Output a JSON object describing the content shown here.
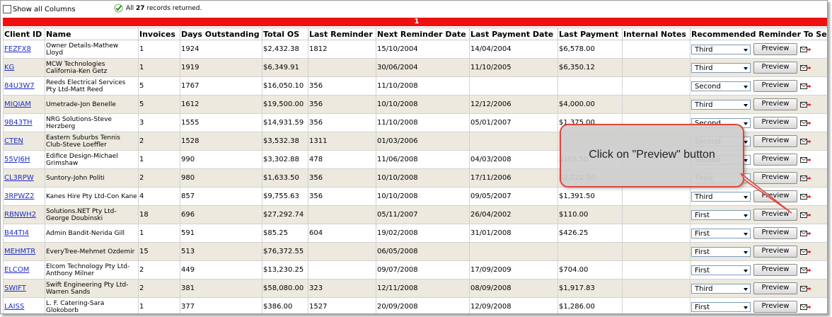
{
  "toolbar": {
    "show_all_label": "Show all Columns",
    "records_prefix": "All",
    "records_count": "27",
    "records_suffix": "records returned."
  },
  "pager": {
    "page": "1"
  },
  "table": {
    "headers": [
      "Client ID",
      "Name",
      "Invoices",
      "Days Outstanding",
      "Total OS",
      "Last Reminder",
      "Next Reminder Date",
      "Last Payment Date",
      "Last Payment",
      "Internal Notes",
      "Recommended Reminder To Send"
    ],
    "preview_label": "Preview",
    "rows": [
      {
        "id": "FEZFX8",
        "name": "Owner Details-Mathew Lloyd",
        "invoices": "1",
        "days": "1924",
        "total": "$2,432.38",
        "last_rem": "1812",
        "next_rem": "15/10/2004",
        "last_pay_date": "14/04/2004",
        "last_pay": "$6,578.00",
        "rec": "Third"
      },
      {
        "id": "KG",
        "name": "MCW Technologies California-Ken Getz",
        "invoices": "1",
        "days": "1919",
        "total": "$6,349.91",
        "last_rem": "",
        "next_rem": "30/06/2004",
        "last_pay_date": "11/10/2005",
        "last_pay": "$6,350.12",
        "rec": "Third"
      },
      {
        "id": "84U3W7",
        "name": "Reeds Electrical Services Pty Ltd-Matt Reed",
        "invoices": "5",
        "days": "1767",
        "total": "$16,050.10",
        "last_rem": "356",
        "next_rem": "11/10/2008",
        "last_pay_date": "",
        "last_pay": "",
        "rec": "Second"
      },
      {
        "id": "MIQIAM",
        "name": "Umetrade-Jon Benelle",
        "invoices": "5",
        "days": "1612",
        "total": "$19,500.00",
        "last_rem": "356",
        "next_rem": "10/10/2008",
        "last_pay_date": "12/12/2006",
        "last_pay": "$4,000.00",
        "rec": "Third"
      },
      {
        "id": "9B43TH",
        "name": "NRG Solutions-Steve Herzberg",
        "invoices": "3",
        "days": "1555",
        "total": "$14,931.59",
        "last_rem": "356",
        "next_rem": "11/10/2008",
        "last_pay_date": "05/01/2007",
        "last_pay": "$1,375.00",
        "rec": "Second"
      },
      {
        "id": "CTEN",
        "name": "Eastern Suburbs Tennis Club-Steve Loeffler",
        "invoices": "2",
        "days": "1528",
        "total": "$3,532.38",
        "last_rem": "1311",
        "next_rem": "01/03/2006",
        "last_pay_date": "",
        "last_pay": "",
        "rec": "Second"
      },
      {
        "id": "55VJ6H",
        "name": "Edifice Design-Michael Grimshaw",
        "invoices": "1",
        "days": "990",
        "total": "$3,302.88",
        "last_rem": "478",
        "next_rem": "11/06/2008",
        "last_pay_date": "04/03/2008",
        "last_pay": "$102.50",
        "rec": "Second"
      },
      {
        "id": "CL3RPW",
        "name": "Suntory-John Politi",
        "invoices": "2",
        "days": "980",
        "total": "$1,633.50",
        "last_rem": "356",
        "next_rem": "10/10/2008",
        "last_pay_date": "17/11/2006",
        "last_pay": "$2,722.50",
        "rec": "Third"
      },
      {
        "id": "3RPWZ2",
        "name": "Kanes Hire Pty Ltd-Con Kane",
        "invoices": "4",
        "days": "857",
        "total": "$9,755.63",
        "last_rem": "356",
        "next_rem": "10/10/2008",
        "last_pay_date": "09/05/2007",
        "last_pay": "$1,391.50",
        "rec": "Third"
      },
      {
        "id": "RBNWH2",
        "name": "Solutions.NET Pty Ltd-George Doubinski",
        "invoices": "18",
        "days": "696",
        "total": "$27,292.74",
        "last_rem": "",
        "next_rem": "05/11/2007",
        "last_pay_date": "26/04/2002",
        "last_pay": "$110.00",
        "rec": "First"
      },
      {
        "id": "B44TI4",
        "name": "Admin Bandit-Nerida Gill",
        "invoices": "1",
        "days": "591",
        "total": "$85.25",
        "last_rem": "604",
        "next_rem": "19/02/2008",
        "last_pay_date": "31/01/2008",
        "last_pay": "$426.25",
        "rec": "First"
      },
      {
        "id": "MEHMTR",
        "name": "EveryTree-Mehmet Ozdemir",
        "invoices": "15",
        "days": "513",
        "total": "$76,372.55",
        "last_rem": "",
        "next_rem": "06/05/2008",
        "last_pay_date": "",
        "last_pay": "",
        "rec": "First"
      },
      {
        "id": "ELCOM",
        "name": "Elcom Technology Pty Ltd-Anthony Milner",
        "invoices": "2",
        "days": "449",
        "total": "$13,230.25",
        "last_rem": "",
        "next_rem": "09/07/2008",
        "last_pay_date": "17/09/2009",
        "last_pay": "$704.00",
        "rec": "First"
      },
      {
        "id": "SWIFT",
        "name": "Swift Engineering Pty Ltd-Warren Sands",
        "invoices": "2",
        "days": "381",
        "total": "$58,080.00",
        "last_rem": "323",
        "next_rem": "12/11/2008",
        "last_pay_date": "08/09/2008",
        "last_pay": "$1,917.83",
        "rec": "Third"
      },
      {
        "id": "LAISS",
        "name": "L. F. Catering-Sara Glokoborb",
        "invoices": "1",
        "days": "377",
        "total": "$386.00",
        "last_rem": "1527",
        "next_rem": "20/09/2008",
        "last_pay_date": "12/09/2008",
        "last_pay": "$1,286.00",
        "rec": "First"
      }
    ]
  },
  "callout": {
    "text": "Click on \"Preview\" button"
  },
  "colors": {
    "header_bar": "#ee1111",
    "link": "#1f2fc8",
    "alt_row": "#ede9de",
    "callout_border": "#e0453c"
  }
}
